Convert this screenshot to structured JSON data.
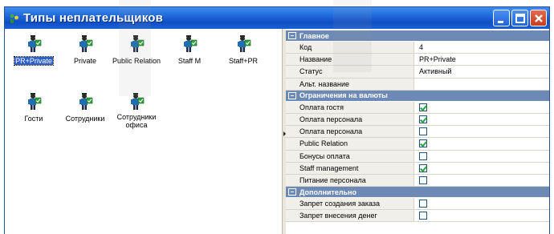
{
  "window": {
    "title": "Типы неплательщиков",
    "title_icon": "app-icon",
    "controls": [
      {
        "name": "minimize-button",
        "icon": "minimize-icon"
      },
      {
        "name": "maximize-button",
        "icon": "maximize-icon"
      },
      {
        "name": "close-button",
        "icon": "close-icon"
      }
    ]
  },
  "types": [
    {
      "label": "PR+Private",
      "selected": true,
      "icon": "person-check-icon"
    },
    {
      "label": "Private",
      "icon": "person-check-icon"
    },
    {
      "label": "Public Relation",
      "icon": "person-check-icon"
    },
    {
      "label": "Staff M",
      "icon": "person-check-icon"
    },
    {
      "label": "Staff+PR",
      "icon": "person-check-icon"
    },
    {
      "label": "Гости",
      "icon": "person-check-icon"
    },
    {
      "label": "Сотрудники",
      "icon": "person-check-icon"
    },
    {
      "label": "Сотрудники офиса",
      "icon": "person-check-icon"
    }
  ],
  "properties": {
    "sections": [
      {
        "title": "Главное",
        "rows": [
          {
            "label": "Код",
            "value": "4"
          },
          {
            "label": "Название",
            "value": "PR+Private"
          },
          {
            "label": "Статус",
            "value": "Активный"
          },
          {
            "label": "Альт. название",
            "value": ""
          }
        ]
      },
      {
        "title": "Ограничения на валюты",
        "rows": [
          {
            "label": "Оплата гостя",
            "checked": true
          },
          {
            "label": "Оплата персонала",
            "checked": true
          },
          {
            "label": "Оплата персонала",
            "checked": false
          },
          {
            "label": "Public Relation",
            "checked": true
          },
          {
            "label": "Бонусы оплата",
            "checked": false
          },
          {
            "label": "Staff management",
            "checked": true
          },
          {
            "label": "Питание персонала",
            "checked": false
          }
        ]
      },
      {
        "title": "Дополнительно",
        "rows": [
          {
            "label": "Запрет создания заказа",
            "checked": false
          },
          {
            "label": "Запрет внесения денег",
            "checked": false
          }
        ]
      }
    ]
  },
  "colors": {
    "title_bar": "#1c64d8",
    "section_header": "#6d89b6",
    "selection": "#2d5fc8",
    "checkmark": "#2ba03b",
    "person_shirt": "#1f6fb2",
    "badge_green": "#2f9b3a"
  }
}
